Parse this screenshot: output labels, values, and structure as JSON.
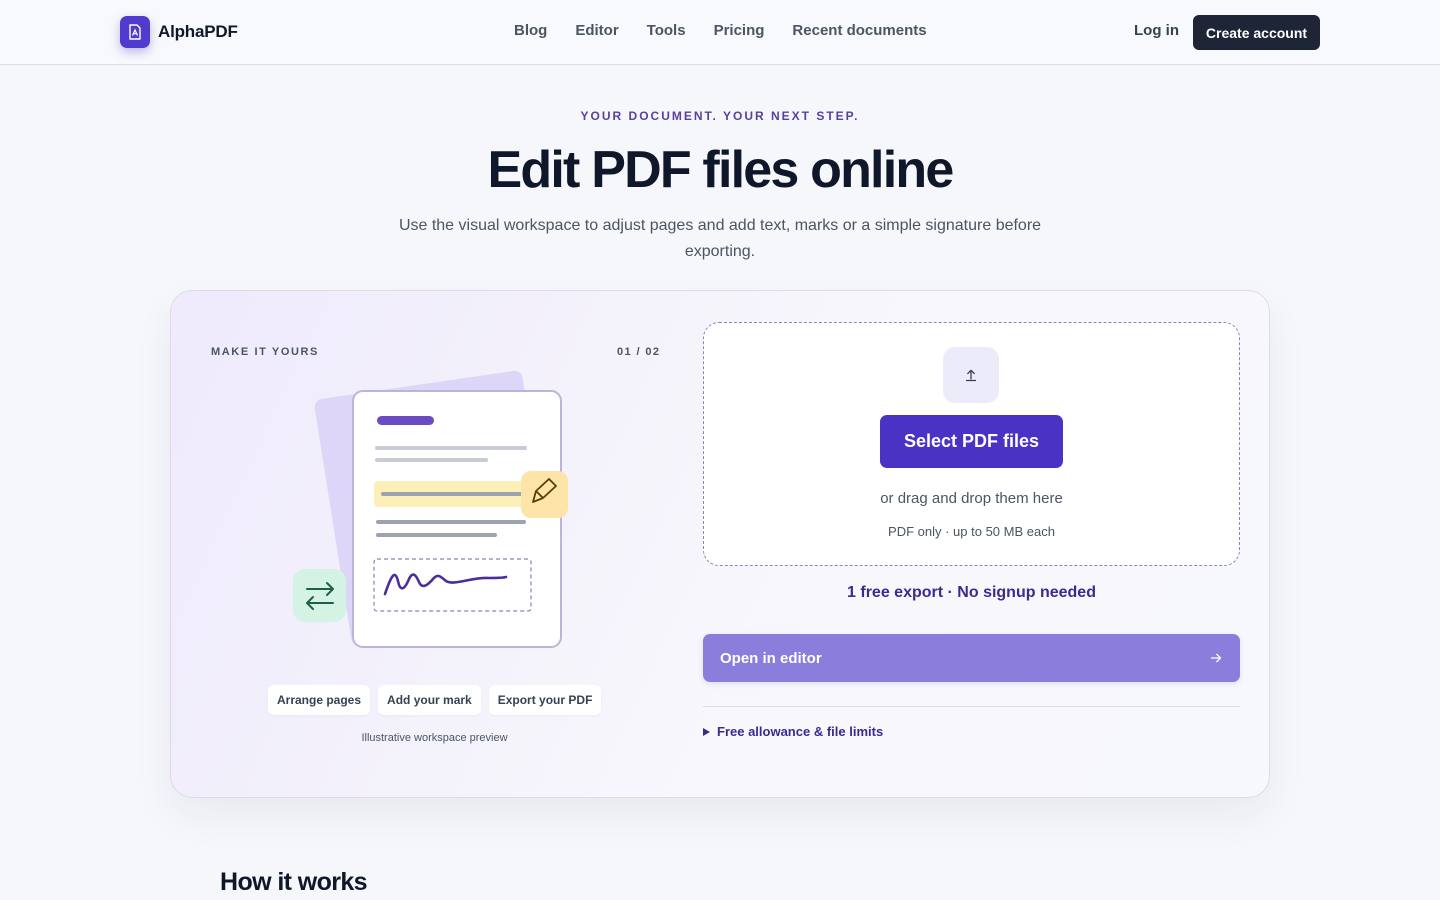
{
  "brand": {
    "name": "AlphaPDF"
  },
  "nav": [
    {
      "label": "Blog"
    },
    {
      "label": "Editor"
    },
    {
      "label": "Tools"
    },
    {
      "label": "Pricing"
    },
    {
      "label": "Recent documents"
    }
  ],
  "auth": {
    "login": "Log in",
    "create": "Create account"
  },
  "hero": {
    "eyebrow": "YOUR DOCUMENT. YOUR NEXT STEP.",
    "title": "Edit PDF files online",
    "subtitle": "Use the visual workspace to adjust pages and add text, marks or a simple signature before exporting."
  },
  "preview": {
    "label": "MAKE IT YOURS",
    "counter": "01 / 02",
    "chips": [
      "Arrange pages",
      "Add your mark",
      "Export your PDF"
    ],
    "caption": "Illustrative workspace preview"
  },
  "upload": {
    "button": "Select PDF files",
    "drag_text": "or drag and drop them here",
    "limits": "PDF only · up to 50 MB each",
    "free_export": "1 free export · No signup needed",
    "open_editor": "Open in editor",
    "allowance": "Free allowance & file limits"
  },
  "how": {
    "title": "How it works"
  },
  "colors": {
    "accent": "#4a32c4",
    "accent_soft": "#8a7ddb",
    "dark": "#1e2536",
    "pen_bg": "#fde4a8",
    "swap_bg": "#d5f3e4"
  },
  "icons": [
    "pdf-file-icon",
    "upload-icon",
    "pen-icon",
    "swap-icon",
    "arrow-right-icon",
    "triangle-right-icon"
  ]
}
